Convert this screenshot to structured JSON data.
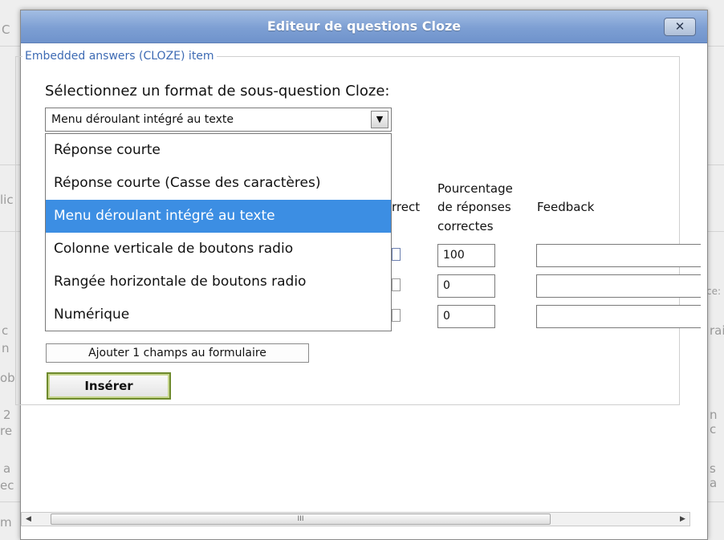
{
  "dialog": {
    "title": "Editeur de questions Cloze",
    "close_label": "✕"
  },
  "fieldset": {
    "legend": "Embedded answers (CLOZE) item"
  },
  "format": {
    "prompt": "Sélectionnez un format de sous-question Cloze:",
    "selected": "Menu déroulant intégré au texte",
    "options": [
      "Réponse courte",
      "Réponse courte (Casse des caractères)",
      "Menu déroulant intégré au texte",
      "Colonne verticale de boutons radio",
      "Rangée horizontale de boutons radio",
      "Numérique"
    ],
    "highlighted_index": 2
  },
  "answers_table": {
    "headers": {
      "correct": "rrect",
      "percent_line1": "Pourcentage",
      "percent_line2": "de réponses",
      "percent_line3": "correctes",
      "feedback": "Feedback"
    },
    "rows": [
      {
        "percent": "100",
        "feedback": ""
      },
      {
        "percent": "0",
        "feedback": ""
      },
      {
        "percent": "0",
        "feedback": ""
      }
    ]
  },
  "buttons": {
    "add_fields": "Ajouter 1 champs au formulaire",
    "insert": "Insérer"
  },
  "scrollbar": {
    "left_arrow": "◀",
    "right_arrow": "▶",
    "grip": "III"
  },
  "background_fragments": [
    "C",
    "lic",
    "c",
    "n",
    "ob",
    "2",
    "re",
    "a",
    "ec",
    "m",
    "rai",
    "n c",
    "s a",
    "ce:"
  ]
}
